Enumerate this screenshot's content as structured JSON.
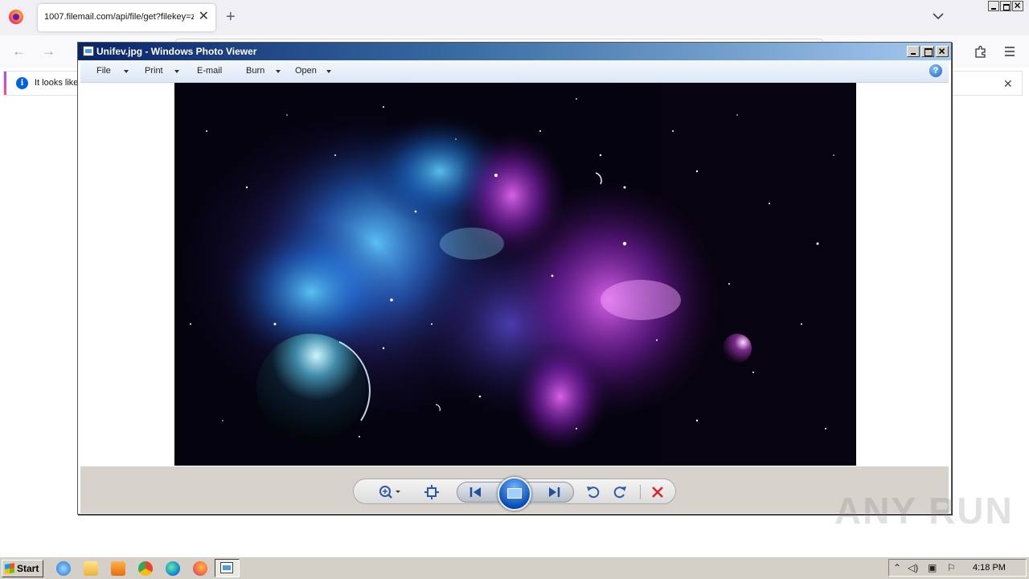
{
  "browser": {
    "tab_title": "1007.filemail.com/api/file/get?filekey=z",
    "tab_close": "✕",
    "new_tab": "+",
    "notice_text": "It looks like",
    "notice_close": "✕"
  },
  "viewer": {
    "title": "Unifev.jpg - Windows Photo Viewer",
    "menu": [
      {
        "label": "File",
        "has_arrow": true
      },
      {
        "label": "Print",
        "has_arrow": true
      },
      {
        "label": "E-mail",
        "has_arrow": false
      },
      {
        "label": "Burn",
        "has_arrow": true
      },
      {
        "label": "Open",
        "has_arrow": true
      }
    ],
    "help": "?",
    "window_buttons": {
      "minimize": "_",
      "maximize": "□",
      "close": "✕"
    },
    "controls": {
      "zoom": "zoom-icon",
      "fit": "actual-size-icon",
      "previous": "previous-icon",
      "slideshow": "slideshow-icon",
      "next": "next-icon",
      "rotate_ccw": "rotate-counterclockwise-icon",
      "rotate_cw": "rotate-clockwise-icon",
      "delete": "delete-icon"
    }
  },
  "watermark": "ANY RUN",
  "taskbar": {
    "start_label": "Start",
    "clock": "4:18 PM",
    "pinned": [
      "internet-explorer-icon",
      "folder-icon",
      "media-player-icon",
      "chrome-icon",
      "edge-icon",
      "firefox-icon",
      "photo-viewer-icon"
    ],
    "tray": [
      "show-hidden-icon",
      "volume-icon",
      "network-icon",
      "flag-icon"
    ]
  },
  "colors": {
    "titlebar_start": "#0a246a",
    "titlebar_end": "#a6caf0",
    "delete_red": "#d22b2b",
    "nebula_blue": "#3fb7ff",
    "nebula_purple": "#c43be0"
  }
}
